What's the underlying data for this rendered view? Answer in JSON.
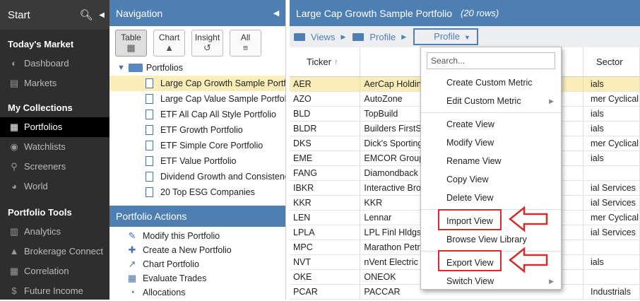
{
  "sidebar": {
    "start": "Start",
    "sections": [
      {
        "title": "Today's Market",
        "items": [
          {
            "label": "Dashboard",
            "icon": "dashboard-icon"
          },
          {
            "label": "Markets",
            "icon": "chart-icon"
          }
        ]
      },
      {
        "title": "My Collections",
        "items": [
          {
            "label": "Portfolios",
            "icon": "portfolio-icon",
            "active": true
          },
          {
            "label": "Watchlists",
            "icon": "binoculars-icon"
          },
          {
            "label": "Screeners",
            "icon": "search-icon"
          },
          {
            "label": "World",
            "icon": "globe-icon"
          }
        ]
      },
      {
        "title": "Portfolio Tools",
        "items": [
          {
            "label": "Analytics",
            "icon": "bar-chart-icon"
          },
          {
            "label": "Brokerage Connect",
            "icon": "bank-icon"
          },
          {
            "label": "Correlation",
            "icon": "grid-icon"
          },
          {
            "label": "Future Income",
            "icon": "dollar-icon"
          }
        ]
      }
    ]
  },
  "nav": {
    "title": "Navigation",
    "view_buttons": [
      {
        "label": "Table",
        "active": true
      },
      {
        "label": "Chart"
      },
      {
        "label": "Insight"
      },
      {
        "label": "All"
      }
    ],
    "folder": "Portfolios",
    "portfolios": [
      "Large Cap Growth Sample Portfolio",
      "Large Cap Value Sample Portfolio",
      "ETF All Cap All Style Portfolio",
      "ETF Growth Portfolio",
      "ETF Simple Core Portfolio",
      "ETF Value Portfolio",
      "Dividend Growth and Consistency",
      "20 Top ESG Companies"
    ],
    "actions_title": "Portfolio Actions",
    "actions": [
      {
        "label": "Modify this Portfolio",
        "icon": "edit-icon"
      },
      {
        "label": "Create a New Portfolio",
        "icon": "plus-icon"
      },
      {
        "label": "Chart Portfolio",
        "icon": "line-chart-icon"
      },
      {
        "label": "Evaluate Trades",
        "icon": "calculator-icon"
      },
      {
        "label": "Allocations",
        "icon": "pie-chart-icon"
      }
    ]
  },
  "main": {
    "title": "Large Cap Growth Sample Portfolio",
    "row_count": "(20 rows)",
    "crumbs": {
      "views": "Views",
      "profile": "Profile",
      "dropdown": "Profile"
    },
    "columns": [
      "Ticker",
      "",
      "Sector"
    ],
    "rows": [
      {
        "ticker": "AER",
        "name": "AerCap Holdings",
        "sector": "ials"
      },
      {
        "ticker": "AZO",
        "name": "AutoZone",
        "sector": "mer Cyclical"
      },
      {
        "ticker": "BLD",
        "name": "TopBuild",
        "sector": "ials"
      },
      {
        "ticker": "BLDR",
        "name": "Builders FirstSource",
        "sector": "ials"
      },
      {
        "ticker": "DKS",
        "name": "Dick's Sporting Goods",
        "sector": "mer Cyclical"
      },
      {
        "ticker": "EME",
        "name": "EMCOR Group",
        "sector": "ials"
      },
      {
        "ticker": "FANG",
        "name": "Diamondback Energy",
        "sector": ""
      },
      {
        "ticker": "IBKR",
        "name": "Interactive Brokers",
        "sector": "ial Services"
      },
      {
        "ticker": "KKR",
        "name": "KKR",
        "sector": "ial Services"
      },
      {
        "ticker": "LEN",
        "name": "Lennar",
        "sector": "mer Cyclical"
      },
      {
        "ticker": "LPLA",
        "name": "LPL Finl Hldgs",
        "sector": "ial Services"
      },
      {
        "ticker": "MPC",
        "name": "Marathon Petroleum",
        "sector": ""
      },
      {
        "ticker": "NVT",
        "name": "nVent Electric",
        "sector": "ials"
      },
      {
        "ticker": "OKE",
        "name": "ONEOK",
        "sector": ""
      },
      {
        "ticker": "PCAR",
        "name": "PACCAR",
        "sector": "Industrials"
      }
    ]
  },
  "menu": {
    "search_placeholder": "Search...",
    "groups": [
      [
        "Create Custom Metric",
        "Edit Custom Metric"
      ],
      [
        "Create View",
        "Modify View",
        "Rename View",
        "Copy View",
        "Delete View"
      ],
      [
        "Import View",
        "Browse View Library"
      ],
      [
        "Export View",
        "Switch View"
      ]
    ]
  },
  "colors": {
    "header": "#4e7fb3",
    "highlight": "#fbedb8",
    "annotation": "#d62b2b"
  }
}
